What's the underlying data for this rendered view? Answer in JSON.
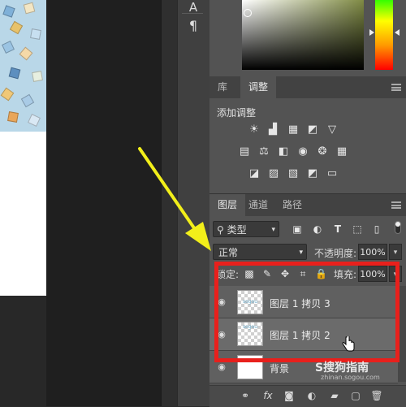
{
  "tools": {
    "type_tool_glyph": "A",
    "paragraph_glyph": "¶"
  },
  "adjustments": {
    "tabs": [
      {
        "label": "库"
      },
      {
        "label": "调整"
      }
    ],
    "add_adjustment_label": "添加调整",
    "row1": [
      "brightness-contrast-icon",
      "levels-icon",
      "curves-icon",
      "exposure-icon",
      "vibrance-icon"
    ],
    "row2": [
      "hue-saturation-icon",
      "color-balance-icon",
      "black-white-icon",
      "photo-filter-icon",
      "channel-mixer-icon",
      "color-lookup-icon"
    ],
    "row3": [
      "invert-icon",
      "posterize-icon",
      "threshold-icon",
      "selective-color-icon",
      "gradient-map-icon"
    ]
  },
  "layers": {
    "tabs": [
      {
        "label": "图层"
      },
      {
        "label": "通道"
      },
      {
        "label": "路径"
      }
    ],
    "filter_kind": "类型",
    "blend_mode": "正常",
    "opacity_label": "不透明度:",
    "opacity_value": "100%",
    "lock_label": "锁定:",
    "fill_label": "填充:",
    "fill_value": "100%",
    "items": [
      {
        "name": "图层 1 拷贝 3",
        "thumb_caption": "sogou"
      },
      {
        "name": "图层 1 拷贝 2",
        "thumb_caption": "sogou"
      },
      {
        "name": "背景"
      }
    ]
  },
  "watermark": {
    "brand": "S搜狗指南",
    "url": "zhinan.sogou.com"
  },
  "colors": {
    "annotation_red": "#e8201c",
    "arrow_yellow": "#f2ef1a",
    "panel_bg": "#535353"
  }
}
